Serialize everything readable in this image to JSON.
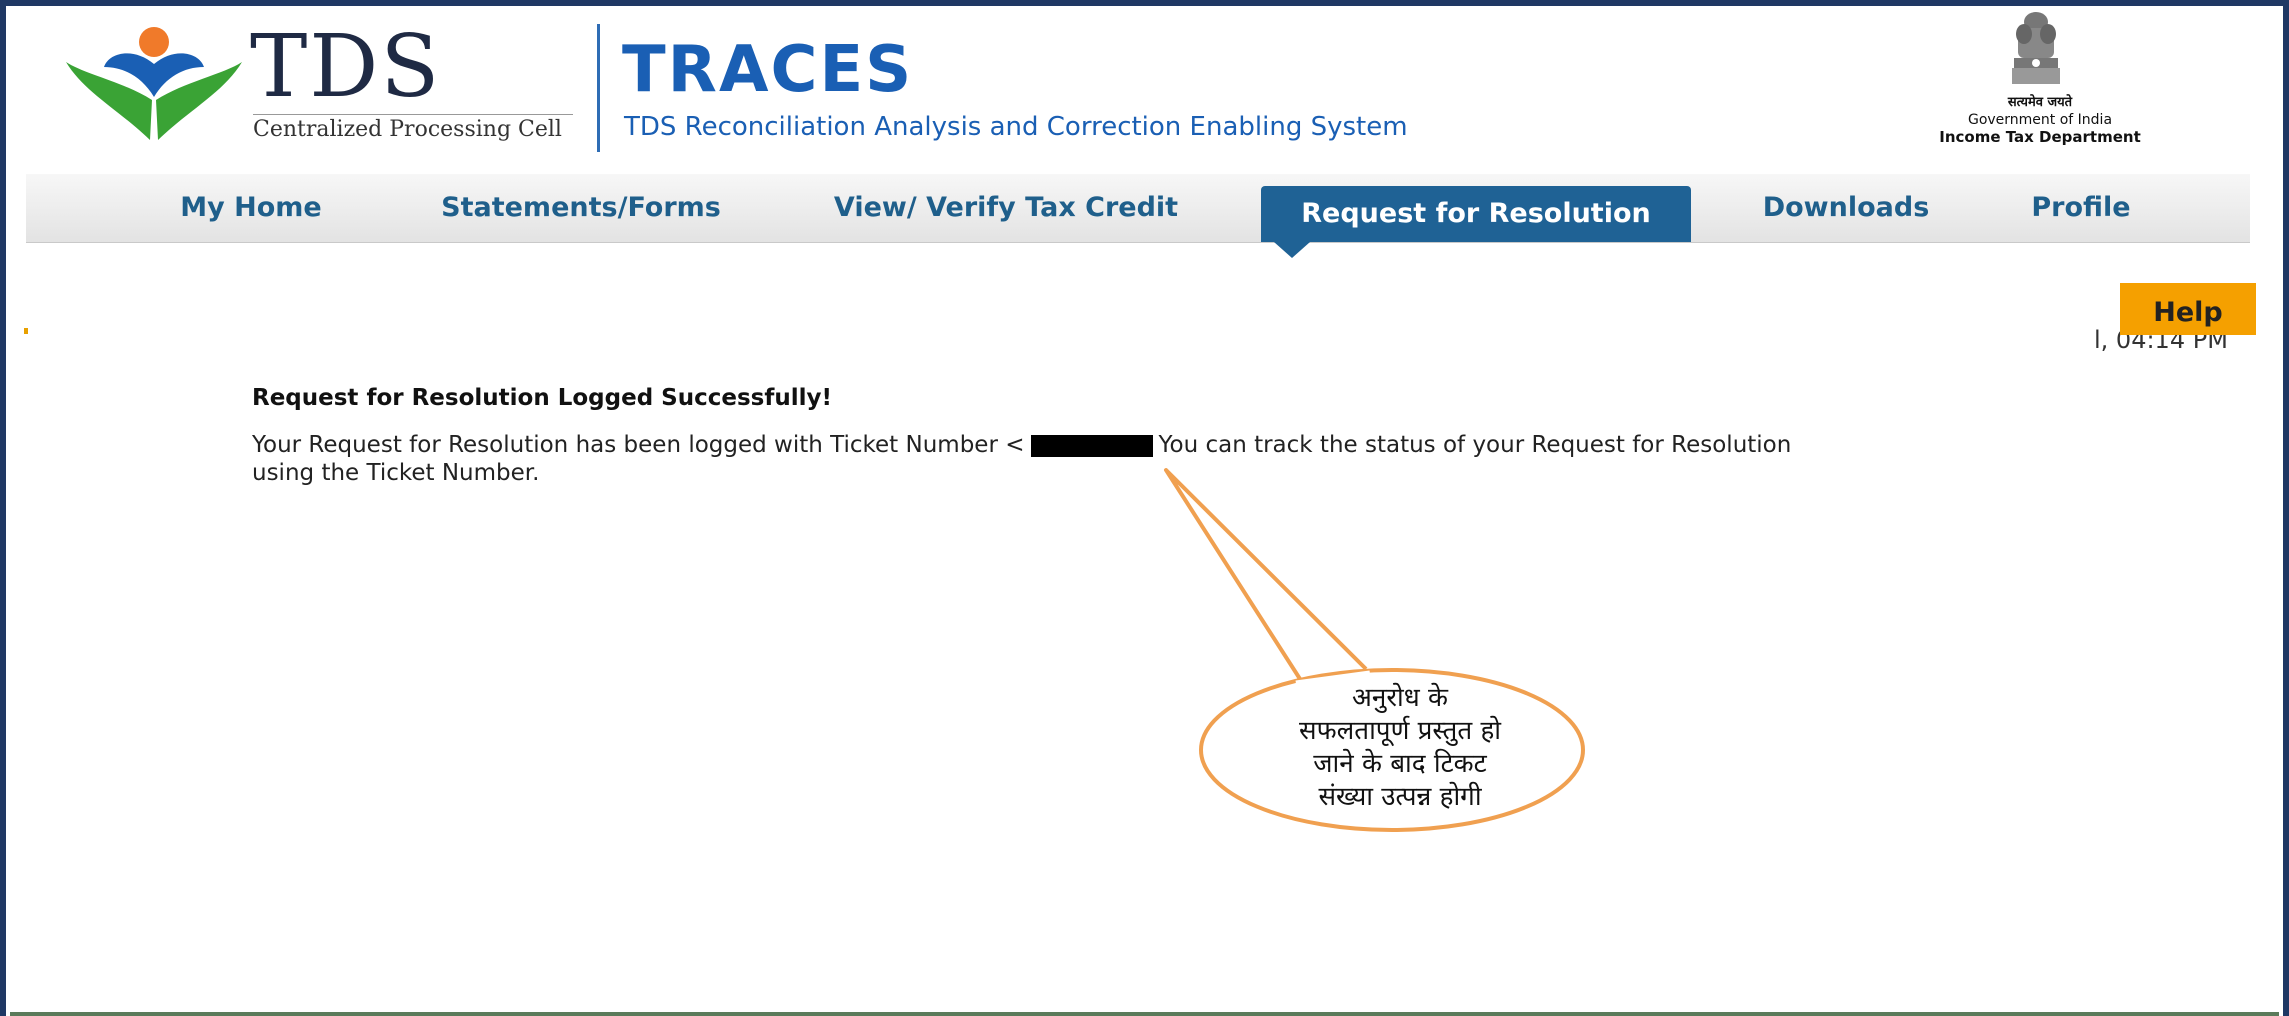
{
  "header": {
    "tds_logo_text": "TDS",
    "tds_subtitle": "Centralized Processing Cell",
    "app_name": "TRACES",
    "app_fullname": "TDS Reconciliation Analysis and Correction Enabling System",
    "gov_motto": "सत्यमेव जयते",
    "gov_name": "Government of India",
    "dept_name": "Income Tax Department"
  },
  "nav": {
    "items": [
      {
        "label": "My Home",
        "active": false
      },
      {
        "label": "Statements/Forms",
        "active": false
      },
      {
        "label": "View/ Verify Tax Credit",
        "active": false
      },
      {
        "label": "Request for Resolution",
        "active": true
      },
      {
        "label": "Downloads",
        "active": false
      },
      {
        "label": "Profile",
        "active": false
      }
    ]
  },
  "help_label": "Help",
  "time_fragment": "l, 04:14 PM",
  "message": {
    "title": "Request for Resolution Logged Successfully!",
    "line1_before": "Your Request for Resolution has been logged with Ticket Number <",
    "line1_after": "You can track the status of your Request for Resolution",
    "line2": "using the Ticket Number."
  },
  "callout": {
    "lines": [
      "अनुरोध के",
      "सफलतापूर्ण प्रस्तुत हो",
      "जाने के बाद टिकट",
      "संख्या उत्पन्न होगी"
    ]
  },
  "colors": {
    "nav_active": "#1f6295",
    "nav_text": "#1f5f8b",
    "help_button": "#f5a000",
    "callout_stroke": "#f0a050",
    "brand_blue": "#1a5fb4"
  }
}
